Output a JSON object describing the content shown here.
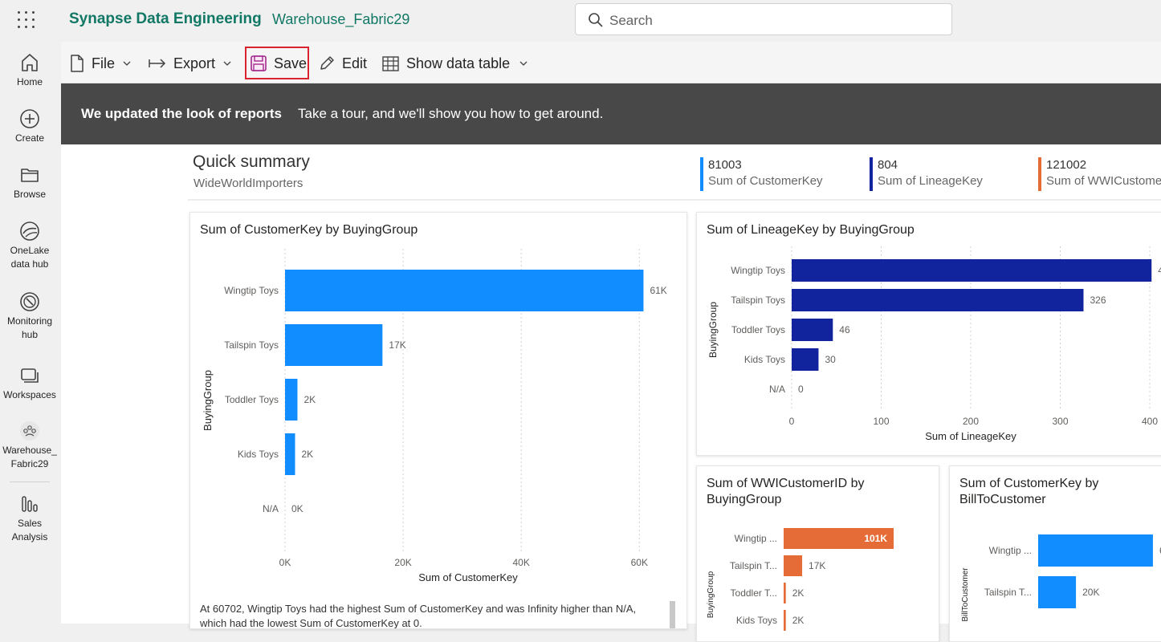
{
  "app": {
    "name": "Synapse Data Engineering",
    "workspace": "Warehouse_Fabric29",
    "search_placeholder": "Search"
  },
  "nav": {
    "items": [
      {
        "label": "Home"
      },
      {
        "label": "Create"
      },
      {
        "label": "Browse"
      },
      {
        "label": "OneLake data hub",
        "line1": "OneLake",
        "line2": "data hub"
      },
      {
        "label": "Monitoring hub",
        "line1": "Monitoring",
        "line2": "hub"
      },
      {
        "label": "Workspaces"
      },
      {
        "label": "Warehouse_Fabric29",
        "line1": "Warehouse_",
        "line2": "Fabric29"
      },
      {
        "label": "Sales Analysis",
        "line1": "Sales",
        "line2": "Analysis"
      }
    ]
  },
  "toolbar": {
    "file": "File",
    "export": "Export",
    "save": "Save",
    "edit": "Edit",
    "show_data_table": "Show data table"
  },
  "banner": {
    "bold": "We updated the look of reports",
    "text": "Take a tour, and we'll show you how to get around."
  },
  "summary": {
    "title": "Quick summary",
    "subtitle": "WideWorldImporters",
    "kpis": [
      {
        "value": "81003",
        "label": "Sum of CustomerKey",
        "color": "#118DFF"
      },
      {
        "value": "804",
        "label": "Sum of LineageKey",
        "color": "#12239E"
      },
      {
        "value": "121002",
        "label": "Sum of WWICustome",
        "color": "#E66C37"
      }
    ]
  },
  "narrative": "At 60702, Wingtip Toys had the highest Sum of CustomerKey and was Infinity higher than N/A, which had the lowest Sum of CustomerKey at 0.",
  "chart_data": [
    {
      "type": "bar",
      "orientation": "horizontal",
      "title": "Sum of CustomerKey by BuyingGroup",
      "xlabel": "Sum of CustomerKey",
      "ylabel": "BuyingGroup",
      "categories": [
        "Wingtip Toys",
        "Tailspin Toys",
        "Toddler Toys",
        "Kids Toys",
        "N/A"
      ],
      "values": [
        60702,
        16500,
        2100,
        1700,
        0
      ],
      "data_labels": [
        "61K",
        "17K",
        "2K",
        "2K",
        "0K"
      ],
      "xticks": [
        "0K",
        "20K",
        "40K",
        "60K"
      ],
      "xlim": [
        0,
        62000
      ],
      "color": "#118DFF",
      "grid": true
    },
    {
      "type": "bar",
      "orientation": "horizontal",
      "title": "Sum of LineageKey by BuyingGroup",
      "xlabel": "Sum of LineageKey",
      "ylabel": "BuyingGroup",
      "categories": [
        "Wingtip Toys",
        "Tailspin Toys",
        "Toddler Toys",
        "Kids Toys",
        "N/A"
      ],
      "values": [
        402,
        326,
        46,
        30,
        0
      ],
      "data_labels": [
        "4",
        "326",
        "46",
        "30",
        "0"
      ],
      "xticks": [
        "0",
        "100",
        "200",
        "300",
        "400"
      ],
      "xlim": [
        0,
        400
      ],
      "color": "#12239E",
      "grid": true
    },
    {
      "type": "bar",
      "orientation": "horizontal",
      "title": "Sum of WWICustomerID by BuyingGroup",
      "title_lines": [
        "Sum of WWICustomerID by",
        "BuyingGroup"
      ],
      "ylabel": "BuyingGroup",
      "categories": [
        "Wingtip ...",
        "Tailspin T...",
        "Toddler T...",
        "Kids Toys"
      ],
      "values": [
        101000,
        17000,
        2000,
        2000
      ],
      "data_labels": [
        "101K",
        "17K",
        "2K",
        "2K"
      ],
      "xlim": [
        0,
        101000
      ],
      "color": "#E66C37"
    },
    {
      "type": "bar",
      "orientation": "horizontal",
      "title": "Sum of CustomerKey by BillToCustomer",
      "title_lines": [
        "Sum of CustomerKey by",
        "BillToCustomer"
      ],
      "ylabel": "BillToCustomer",
      "categories": [
        "Wingtip ...",
        "Tailspin T..."
      ],
      "values": [
        60702,
        20000
      ],
      "data_labels": [
        "6",
        "20K"
      ],
      "xlim": [
        0,
        62000
      ],
      "color": "#118DFF"
    }
  ]
}
